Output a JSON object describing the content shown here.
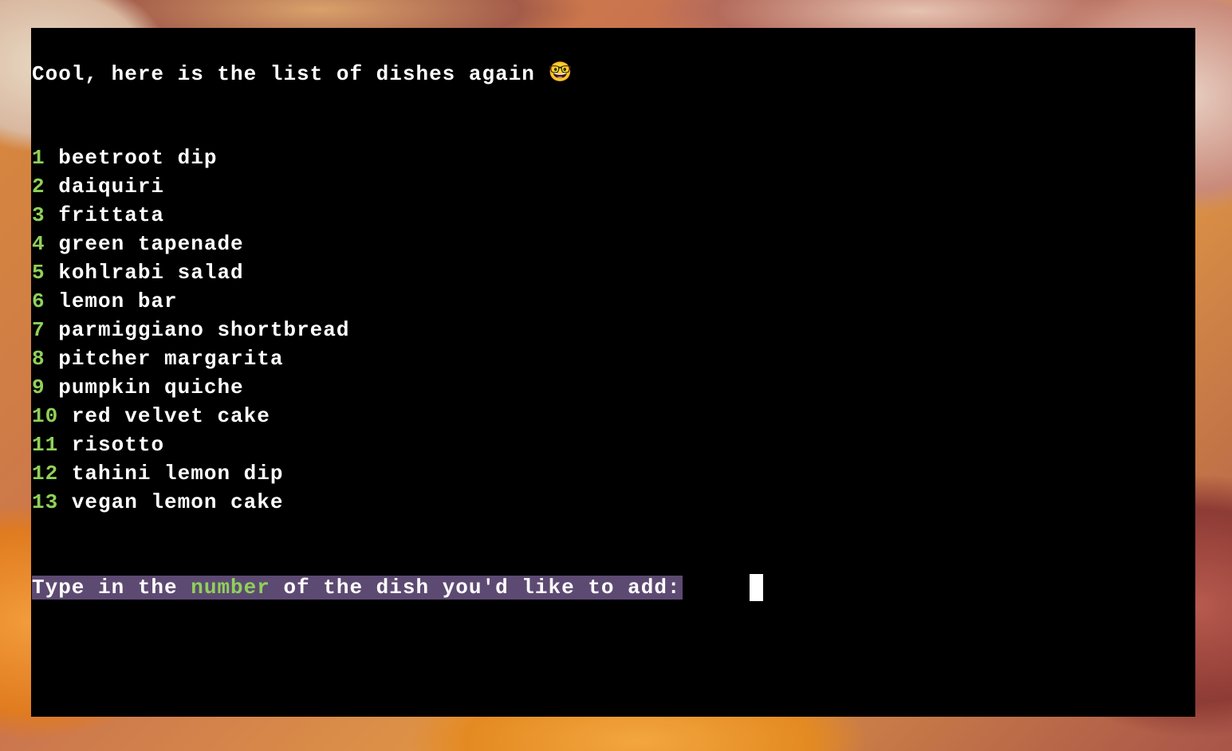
{
  "terminal": {
    "intro_text": "Cool, here is the list of dishes again",
    "intro_emoji": "🤓",
    "dishes": [
      {
        "number": "1",
        "name": "beetroot dip"
      },
      {
        "number": "2",
        "name": "daiquiri"
      },
      {
        "number": "3",
        "name": "frittata"
      },
      {
        "number": "4",
        "name": "green tapenade"
      },
      {
        "number": "5",
        "name": "kohlrabi salad"
      },
      {
        "number": "6",
        "name": "lemon bar"
      },
      {
        "number": "7",
        "name": "parmiggiano shortbread"
      },
      {
        "number": "8",
        "name": "pitcher margarita"
      },
      {
        "number": "9",
        "name": "pumpkin quiche"
      },
      {
        "number": "10",
        "name": "red velvet cake"
      },
      {
        "number": "11",
        "name": "risotto"
      },
      {
        "number": "12",
        "name": "tahini lemon dip"
      },
      {
        "number": "13",
        "name": "vegan lemon cake"
      }
    ],
    "prompt": {
      "before": "Type in the ",
      "highlight": "number",
      "after": " of the dish you'd like to add:"
    },
    "input_value": ""
  },
  "colors": {
    "terminal_background": "#000000",
    "text": "#ffffff",
    "number_accent": "#8fd15a",
    "prompt_highlight": "#5d4a72",
    "cursor": "#ffffff"
  }
}
